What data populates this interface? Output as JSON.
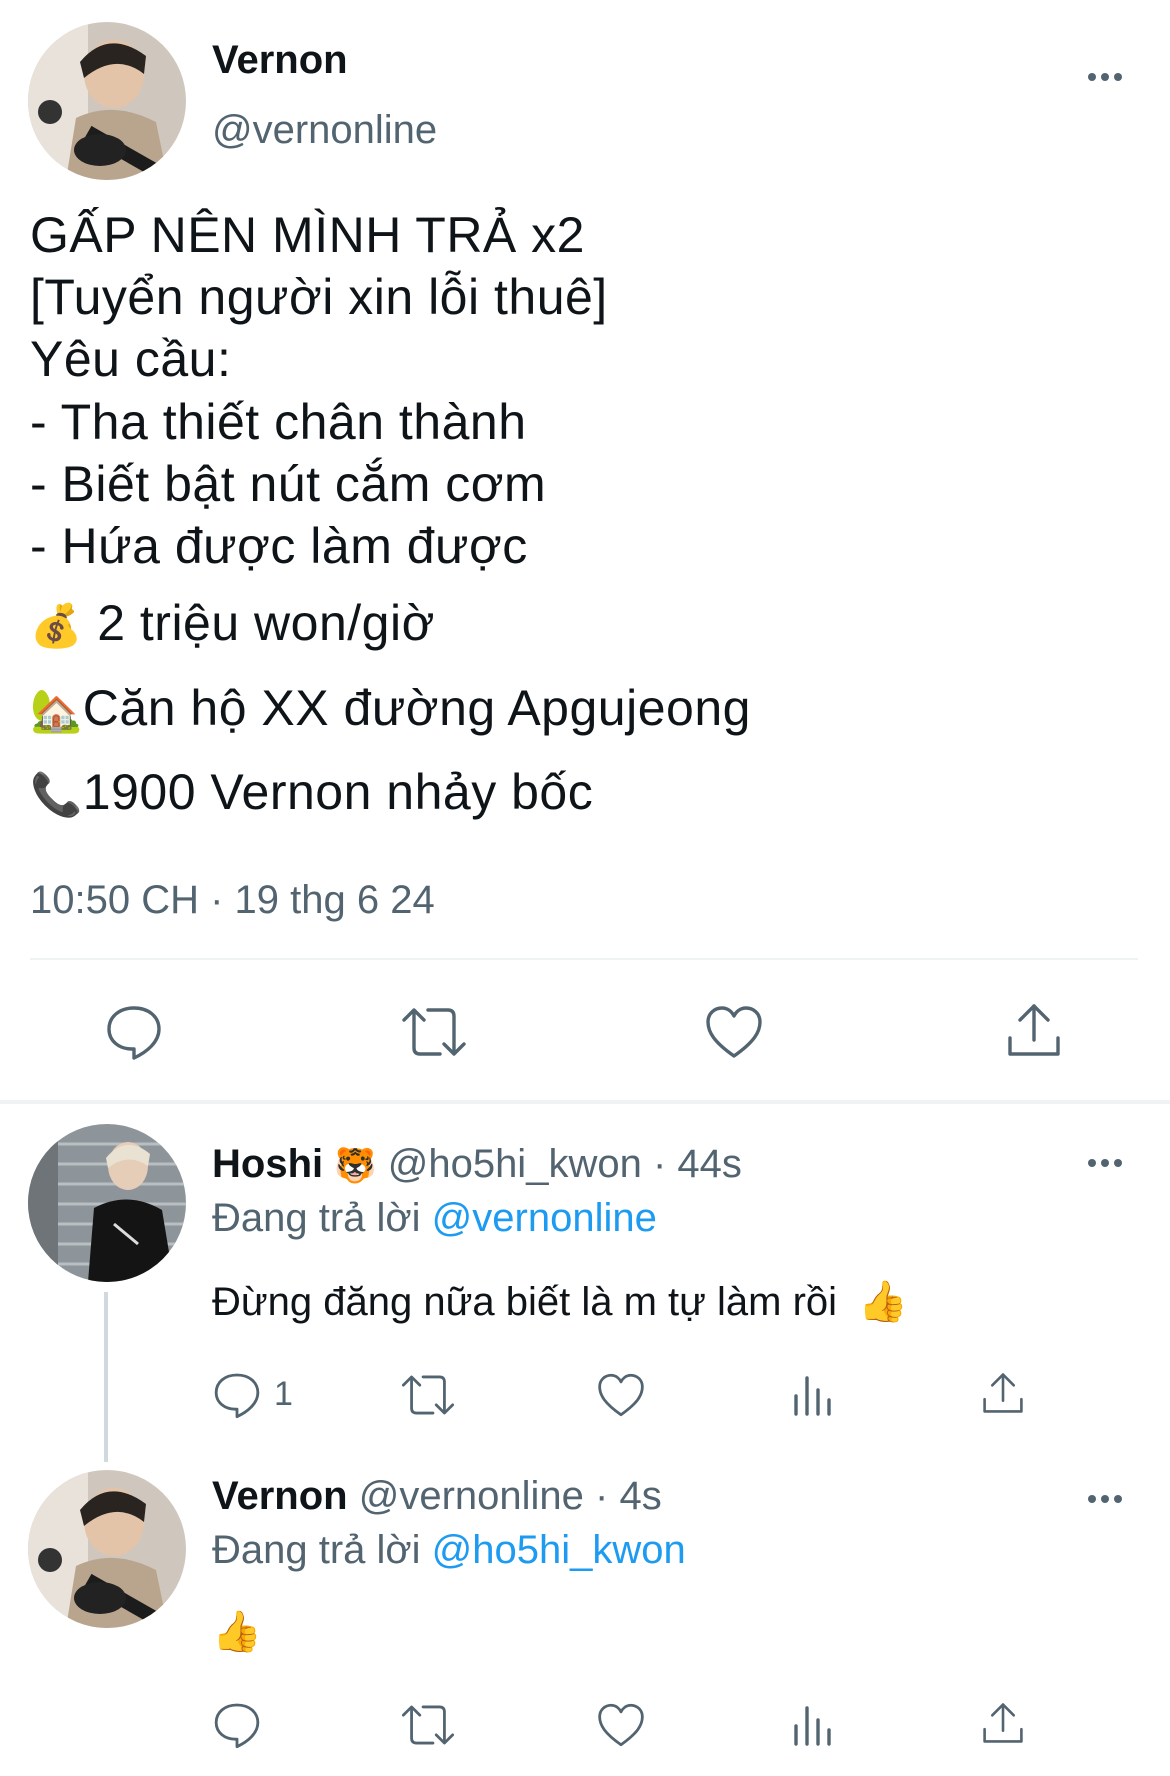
{
  "main_tweet": {
    "author_name": "Vernon",
    "author_handle": "@vernonline",
    "lines": [
      "GẤP NÊN MÌNH TRẢ x2",
      "[Tuyển người xin lỗi thuê]",
      "Yêu cầu:",
      "- Tha thiết chân thành",
      "- Biết bật nút cắm cơm",
      "- Hứa được làm được"
    ],
    "price_emoji": "💰",
    "price": "2 triệu won/giờ",
    "address_emoji": "🏡",
    "address": "Căn hộ XX đường Apgujeong",
    "phone_emoji": "📞",
    "phone": "1900 Vernon nhảy bốc",
    "timestamp": "10:50 CH · 19 thg 6 24"
  },
  "replies": [
    {
      "author_name": "Hoshi",
      "author_emoji": "🐯",
      "author_handle": "@ho5hi_kwon",
      "time": "· 44s",
      "replying_prefix": "Đang trả lời",
      "replying_to": "@vernonline",
      "text": "Đừng đăng nữa biết là m tự làm rồi",
      "text_emoji": "👍",
      "reply_count": "1"
    },
    {
      "author_name": "Vernon",
      "author_handle": "@vernonline",
      "time": "· 4s",
      "replying_prefix": "Đang trả lời",
      "replying_to": "@ho5hi_kwon",
      "text_emoji": "👍"
    }
  ],
  "colors": {
    "text": "#0f1419",
    "secondary": "#536471",
    "accent": "#1d9bf0",
    "divider": "#eff3f4"
  },
  "icons": [
    "more-icon",
    "reply-icon",
    "retweet-icon",
    "like-icon",
    "views-icon",
    "share-icon"
  ]
}
